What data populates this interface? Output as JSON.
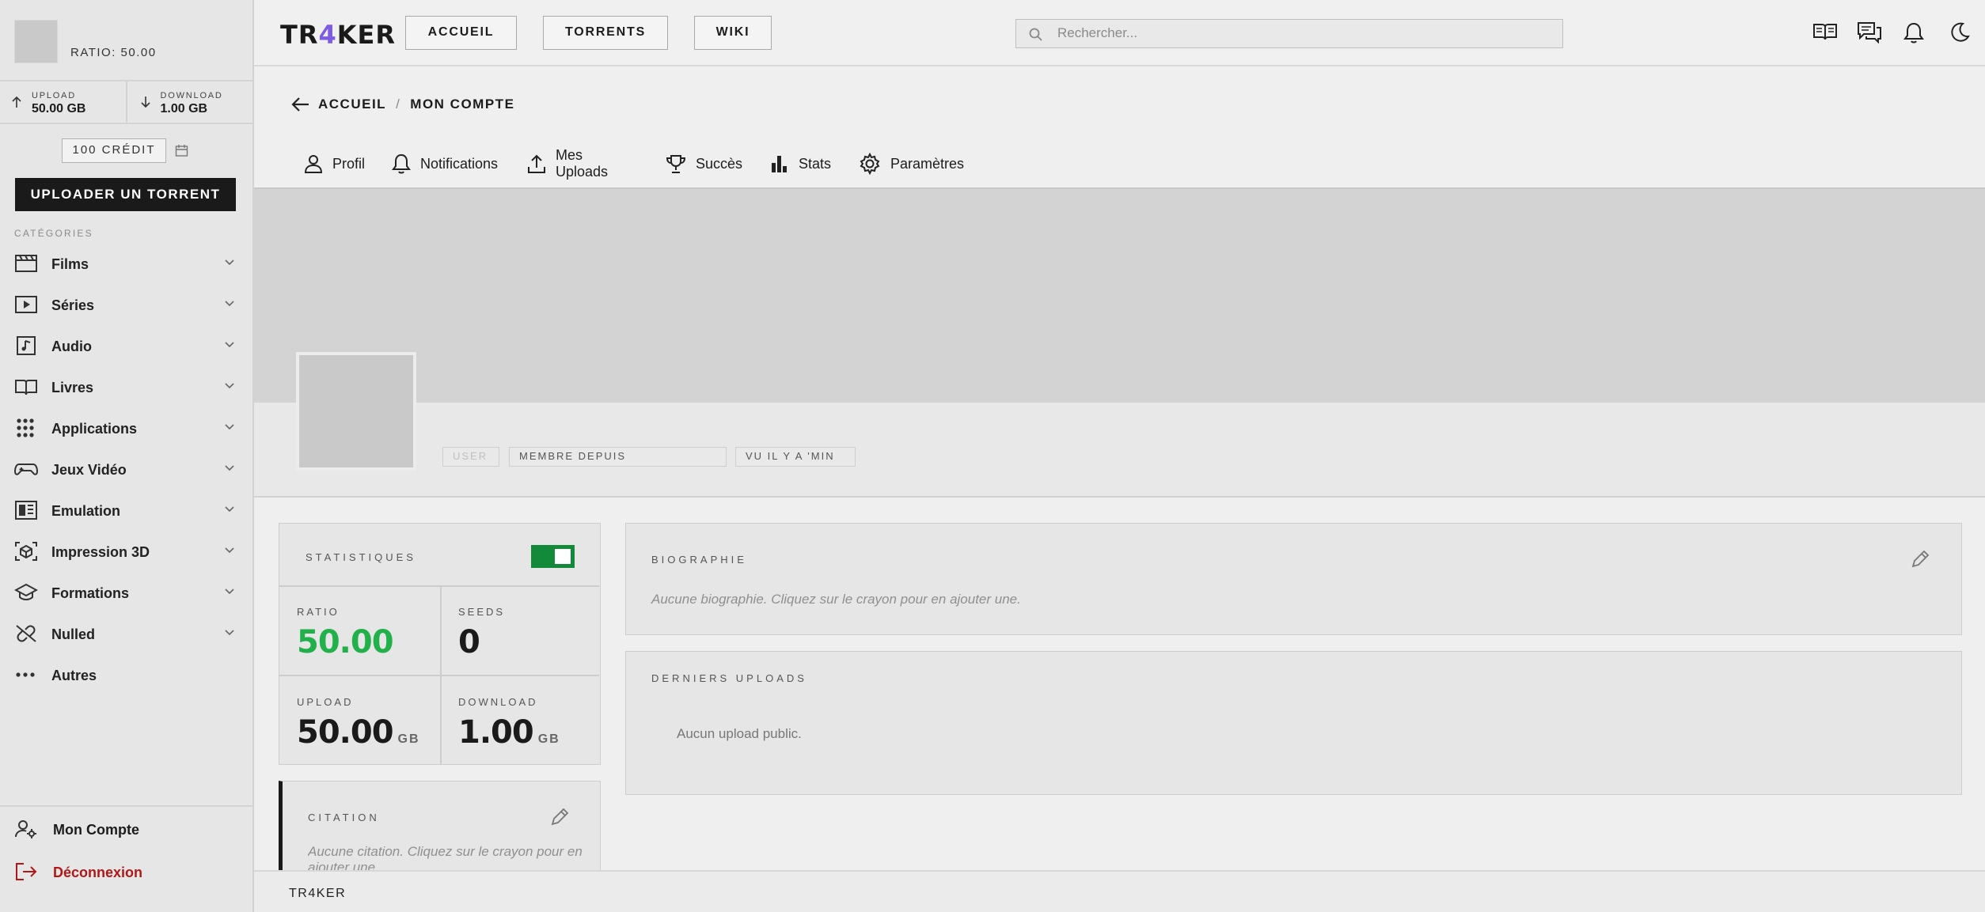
{
  "sidebar": {
    "ratio_text": "RATIO: 50.00",
    "upload": {
      "label": "UPLOAD",
      "value": "50.00 GB"
    },
    "download": {
      "label": "DOWNLOAD",
      "value": "1.00 GB"
    },
    "credit": "100 CRÉDIT",
    "upload_button": "UPLOADER UN TORRENT",
    "categories_title": "CATÉGORIES",
    "categories": [
      {
        "label": "Films",
        "icon": "film-icon"
      },
      {
        "label": "Séries",
        "icon": "tv-play-icon"
      },
      {
        "label": "Audio",
        "icon": "music-file-icon"
      },
      {
        "label": "Livres",
        "icon": "book-icon"
      },
      {
        "label": "Applications",
        "icon": "apps-grid-icon"
      },
      {
        "label": "Jeux Vidéo",
        "icon": "gamepad-icon"
      },
      {
        "label": "Emulation",
        "icon": "emulation-icon"
      },
      {
        "label": "Impression 3D",
        "icon": "cube-3d-icon"
      },
      {
        "label": "Formations",
        "icon": "graduation-cap-icon"
      },
      {
        "label": "Nulled",
        "icon": "link-broken-icon"
      },
      {
        "label": "Autres",
        "icon": "more-dots-icon"
      }
    ],
    "account": "Mon Compte",
    "logout": "Déconnexion",
    "logout_color": "#b01818"
  },
  "topbar": {
    "logo_prefix": "TR",
    "logo_accent": "4",
    "logo_suffix": "KER",
    "logo_accent_color": "#7c5ce0",
    "nav": [
      "ACCUEIL",
      "TORRENTS",
      "WIKI"
    ],
    "search_placeholder": "Rechercher..."
  },
  "breadcrumb": {
    "home": "ACCUEIL",
    "separator": "/",
    "current": "MON COMPTE"
  },
  "tabs": [
    "Profil",
    "Notifications",
    "Mes Uploads",
    "Succès",
    "Stats",
    "Paramètres"
  ],
  "profile": {
    "badges": [
      "USER",
      "MEMBRE DEPUIS",
      "VU IL Y A   'MIN"
    ]
  },
  "stats_card": {
    "title": "STATISTIQUES",
    "toggle_on": true,
    "toggle_color": "#138a3a",
    "ratio": {
      "label": "RATIO",
      "value": "50.00",
      "color": "#22b04b"
    },
    "seeds": {
      "label": "SEEDS",
      "value": "0"
    },
    "upload": {
      "label": "UPLOAD",
      "value": "50.00",
      "unit": "GB"
    },
    "download": {
      "label": "DOWNLOAD",
      "value": "1.00",
      "unit": "GB"
    }
  },
  "quote_card": {
    "title": "CITATION",
    "text": "Aucune citation. Cliquez sur le crayon pour en ajouter une."
  },
  "bio_card": {
    "title": "BIOGRAPHIE",
    "text": "Aucune biographie. Cliquez sur le crayon pour en ajouter une."
  },
  "uploads_card": {
    "title": "DERNIERS UPLOADS",
    "text": "Aucun upload public."
  },
  "footer": {
    "brand": "TR4KER"
  }
}
